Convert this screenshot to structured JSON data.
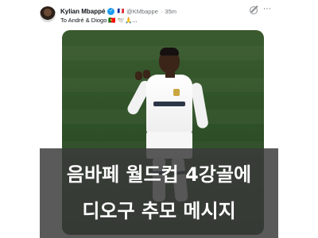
{
  "tweet": {
    "display_name": "Kylian Mbappé",
    "badges_text": "🇫🇷",
    "handle": "@KMbappe",
    "separator": "·",
    "time": "35m",
    "text": "To André & Diogo",
    "text_emojis": "🇵🇹 🕊️🙏..."
  },
  "media": {
    "caption_line_1": "음바페 월드컵 4강골에",
    "caption_line_2": "디오구 추모 메시지"
  },
  "icons": {
    "avatar": "avatar-image",
    "verified": "verified-badge-icon",
    "grok": "grok-icon",
    "more": "more-options-icon"
  },
  "colors": {
    "verified_blue": "#1d9bf0",
    "caption_overlay": "#3a3a3a"
  }
}
